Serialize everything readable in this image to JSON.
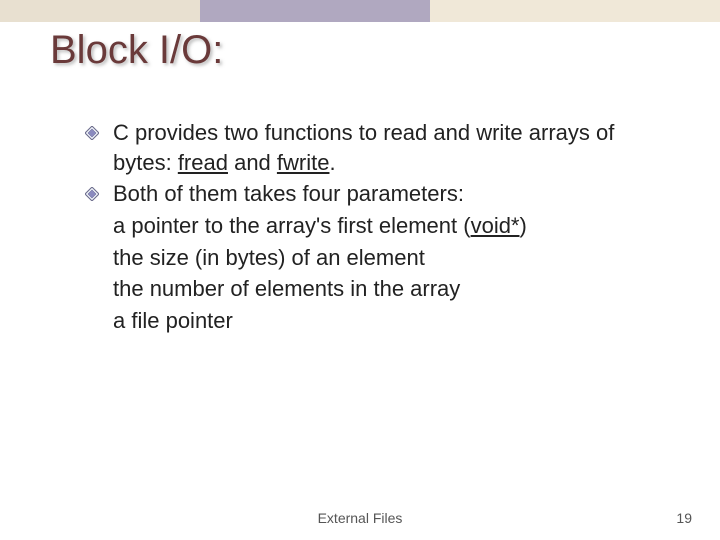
{
  "title": "Block I/O:",
  "bullets": [
    {
      "pre": "C provides two functions to read and write arrays of bytes: ",
      "u1": "fread",
      "mid": " and ",
      "u2": "fwrite",
      "post": "."
    },
    {
      "text": "Both of them takes four parameters:"
    }
  ],
  "sublines": {
    "s1_pre": "a pointer to the array's first element (",
    "s1_u": "void*",
    "s1_post": ")",
    "s2": "the size (in bytes) of an element",
    "s3": "the number of elements in the array",
    "s4": "a file pointer"
  },
  "footer": {
    "center": "External Files",
    "page": "19"
  }
}
